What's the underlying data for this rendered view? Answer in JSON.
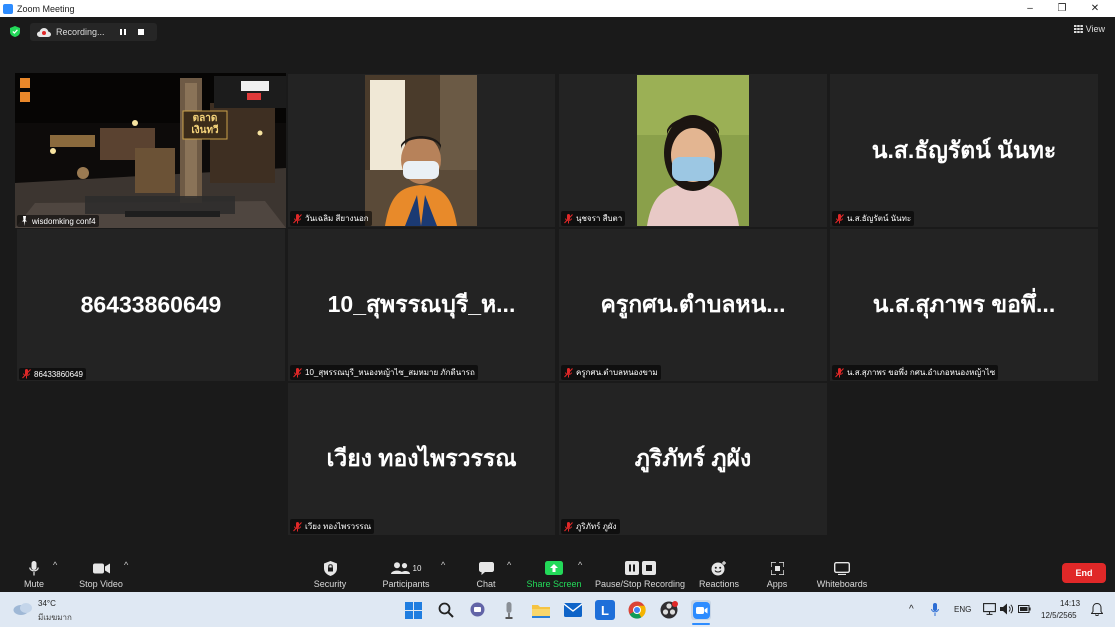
{
  "window": {
    "title": "Zoom Meeting"
  },
  "header": {
    "recording_label": "Recording...",
    "view_label": "View"
  },
  "colors": {
    "accent": "#2d8cff",
    "end": "#e02828",
    "active_speaker": "#e5e37a",
    "share_green": "#23d959"
  },
  "tiles": [
    {
      "name": "wisdomking conf4",
      "big": ""
    },
    {
      "name": "วันเฉลิม สียางนอก",
      "big": ""
    },
    {
      "name": "นุชจรา สืบตา",
      "big": ""
    },
    {
      "name": "น.ส.ธัญรัตน์ นันทะ",
      "big": "น.ส.ธัญรัตน์ นันทะ"
    },
    {
      "name": "86433860649",
      "big": "86433860649"
    },
    {
      "name": "10_สุพรรณบุรี_หนองหญ้าไซ_สมหมาย ภักดีนารถ",
      "big": "10_สุพรรณบุรี_ห..."
    },
    {
      "name": "ครูกศน.ตำบลหนองขาม",
      "big": "ครูกศน.ตำบลหน..."
    },
    {
      "name": "น.ส.สุภาพร ขอพึ่ง กศน.อำเภอหนองหญ้าไซ",
      "big": "น.ส.สุภาพร  ขอพึ่..."
    },
    {
      "name": "เวียง ทองไพรวรรณ",
      "big": "เวียง ทองไพรวรรณ"
    },
    {
      "name": "ภูริภัทร์ ภูผัง",
      "big": "ภูริภัทร์  ภูผัง"
    }
  ],
  "video": {
    "signage_text": "ตลาด เงินทวี"
  },
  "toolbar": {
    "mute": "Mute",
    "stop_video": "Stop Video",
    "security": "Security",
    "participants": "Participants",
    "participants_count": "10",
    "chat": "Chat",
    "share_screen": "Share Screen",
    "pause_stop_recording": "Pause/Stop Recording",
    "reactions": "Reactions",
    "apps": "Apps",
    "whiteboards": "Whiteboards",
    "end": "End"
  },
  "taskbar": {
    "temperature": "34°C",
    "weather": "มีเมฆมาก",
    "language": "ENG",
    "time": "14:13",
    "date": "12/5/2565",
    "apps": [
      "windows-start",
      "search",
      "teams-chat",
      "microphone-app",
      "file-explorer",
      "mail",
      "l-app",
      "chrome",
      "obs-studio",
      "zoom"
    ]
  }
}
